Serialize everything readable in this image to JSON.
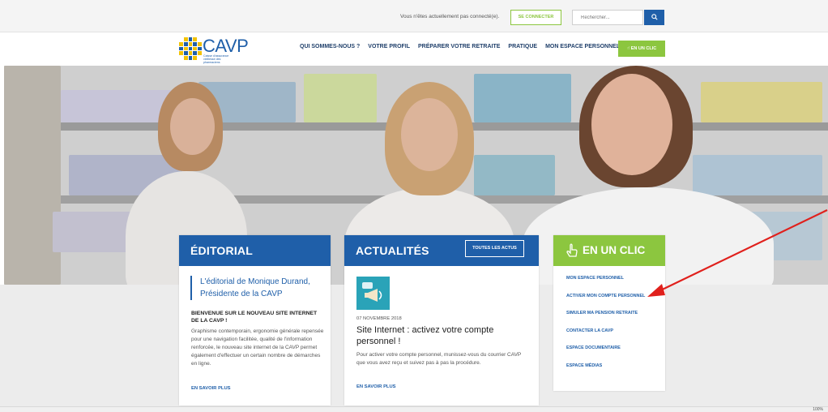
{
  "topbar": {
    "login_message": "Vous n'êtes actuellement pas connecté(e).",
    "connect_label": "SE CONNECTER",
    "search_placeholder": "Rechercher..."
  },
  "logo": {
    "name": "CAVP",
    "subtitle": "Caisse d'assurance vieillesse des pharmaciens"
  },
  "nav": {
    "items": [
      {
        "label": "QUI SOMMES-NOUS ?"
      },
      {
        "label": "VOTRE PROFIL"
      },
      {
        "label": "PRÉPARER VOTRE RETRAITE"
      },
      {
        "label": "PRATIQUE"
      },
      {
        "label": "MON ESPACE PERSONNEL"
      }
    ],
    "clic_label": "EN UN CLIC"
  },
  "editorial": {
    "title": "ÉDITORIAL",
    "quote": "L'éditorial de Monique Durand, Présidente de la CAVP",
    "subtitle": "BIENVENUE SUR LE NOUVEAU SITE INTERNET DE LA CAVP !",
    "body": "Graphisme contemporain, ergonomie générale repensée pour une navigation facilitée, qualité de l'information renforcée, le nouveau site internet de la CAVP permet également d'effectuer un certain nombre de démarches en ligne.",
    "more": "EN SAVOIR PLUS"
  },
  "actualites": {
    "title": "ACTUALITÉS",
    "all_label": "TOUTES LES ACTUS",
    "date": "07 NOVEMBRE 2018",
    "headline": "Site Internet : activez votre compte personnel !",
    "body": "Pour activer votre compte personnel, munissez-vous du courrier CAVP que vous avez reçu et suivez pas à pas la procédure.",
    "more": "EN SAVOIR PLUS"
  },
  "en_un_clic": {
    "title": "EN UN CLIC",
    "links": [
      {
        "label": "MON ESPACE PERSONNEL"
      },
      {
        "label": "ACTIVER MON COMPTE PERSONNEL"
      },
      {
        "label": "SIMULER MA PENSION RETRAITE"
      },
      {
        "label": "CONTACTER LA CAVP"
      },
      {
        "label": "ESPACE DOCUMENTAIRE"
      },
      {
        "label": "ESPACE MÉDIAS"
      }
    ]
  },
  "statusbar": {
    "zoom": "100%"
  },
  "colors": {
    "brand_blue": "#1f5fa9",
    "brand_green": "#8cc63f",
    "logo_yellow": "#f2c200",
    "annotation_red": "#e0201c"
  }
}
